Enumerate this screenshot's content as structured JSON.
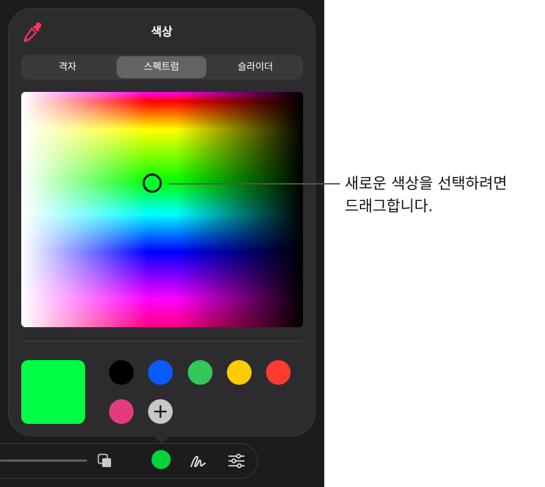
{
  "popover": {
    "title": "색상",
    "tabs": [
      {
        "label": "격자",
        "active": false
      },
      {
        "label": "스펙트럼",
        "active": true
      },
      {
        "label": "슬라이더",
        "active": false
      }
    ]
  },
  "current_color": "#00ff44",
  "swatches": [
    {
      "name": "black",
      "color": "#000000"
    },
    {
      "name": "blue",
      "color": "#0a5bff"
    },
    {
      "name": "green",
      "color": "#34c759"
    },
    {
      "name": "yellow",
      "color": "#ffcc00"
    },
    {
      "name": "red",
      "color": "#ff3b30"
    },
    {
      "name": "pink",
      "color": "#e63a7f"
    }
  ],
  "icons": {
    "eyedropper": "eyedropper-icon",
    "add": "plus-icon",
    "copy": "copy-icon",
    "stroke": "pen-stroke-icon",
    "adjust": "sliders-icon"
  },
  "callout": {
    "line1": "새로운 색상을 선택하려면",
    "line2": "드래그합니다."
  }
}
